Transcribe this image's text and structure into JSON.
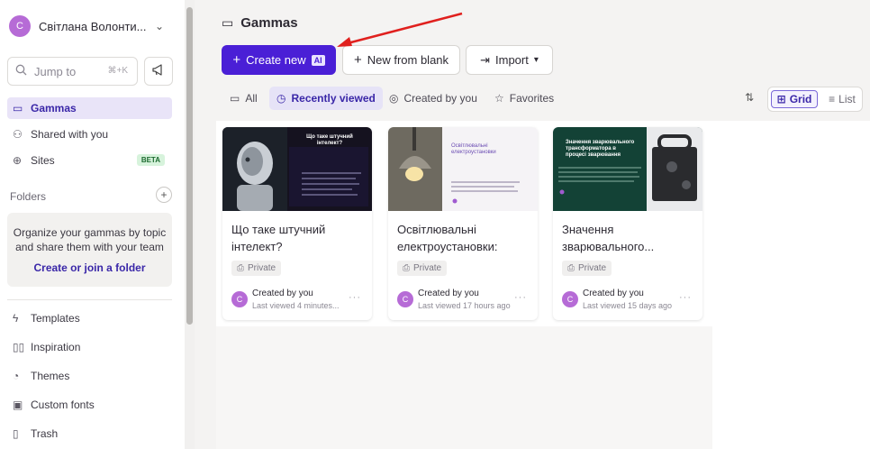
{
  "sidebar": {
    "account": {
      "avatar_letter": "C",
      "name": "Світлана Волонти..."
    },
    "jump": {
      "placeholder": "Jump to",
      "shortcut": "⌘+K"
    },
    "nav": [
      {
        "label": "Gammas",
        "icon": "gammas-icon",
        "active": true
      },
      {
        "label": "Shared with you",
        "icon": "people-icon"
      },
      {
        "label": "Sites",
        "icon": "globe-icon",
        "badge": "BETA"
      }
    ],
    "folders": {
      "header": "Folders",
      "empty_text": "Organize your gammas by topic and share them with your team",
      "create_link": "Create or join a folder"
    },
    "bottom_nav": [
      {
        "label": "Templates",
        "icon": "templates-icon"
      },
      {
        "label": "Inspiration",
        "icon": "book-icon"
      },
      {
        "label": "Themes",
        "icon": "palette-icon"
      },
      {
        "label": "Custom fonts",
        "icon": "font-icon"
      },
      {
        "label": "Trash",
        "icon": "trash-icon"
      }
    ]
  },
  "main": {
    "title": "Gammas",
    "buttons": {
      "create": "Create new",
      "create_badge": "AI",
      "blank": "New from blank",
      "import": "Import"
    },
    "tabs": [
      {
        "label": "All"
      },
      {
        "label": "Recently viewed",
        "active": true
      },
      {
        "label": "Created by you"
      },
      {
        "label": "Favorites"
      }
    ],
    "view": {
      "grid": "Grid",
      "list": "List"
    },
    "cards": [
      {
        "title": "Що таке штучний інтелект?",
        "thumb_title": "Що таке штучний інтелект?",
        "privacy": "Private",
        "creator": "Created by you",
        "avatar_letter": "C",
        "viewed": "Last viewed 4 minutes..."
      },
      {
        "title": "Освітлювальні електроустановки:",
        "thumb_title": "Освітлювальні електроустановки",
        "privacy": "Private",
        "creator": "Created by you",
        "avatar_letter": "C",
        "viewed": "Last viewed 17 hours ago"
      },
      {
        "title": "Значення зварювального...",
        "thumb_title": "Значення зварювального трансформатора в процесі зварювання",
        "privacy": "Private",
        "creator": "Created by you",
        "avatar_letter": "C",
        "viewed": "Last viewed 15 days ago"
      }
    ]
  },
  "colors": {
    "accent": "#4a1fd6",
    "active_bg": "#e9e4f8",
    "avatar": "#b66bd6",
    "beta_bg": "#d7f3dc",
    "annotation_arrow": "#e0201e"
  }
}
